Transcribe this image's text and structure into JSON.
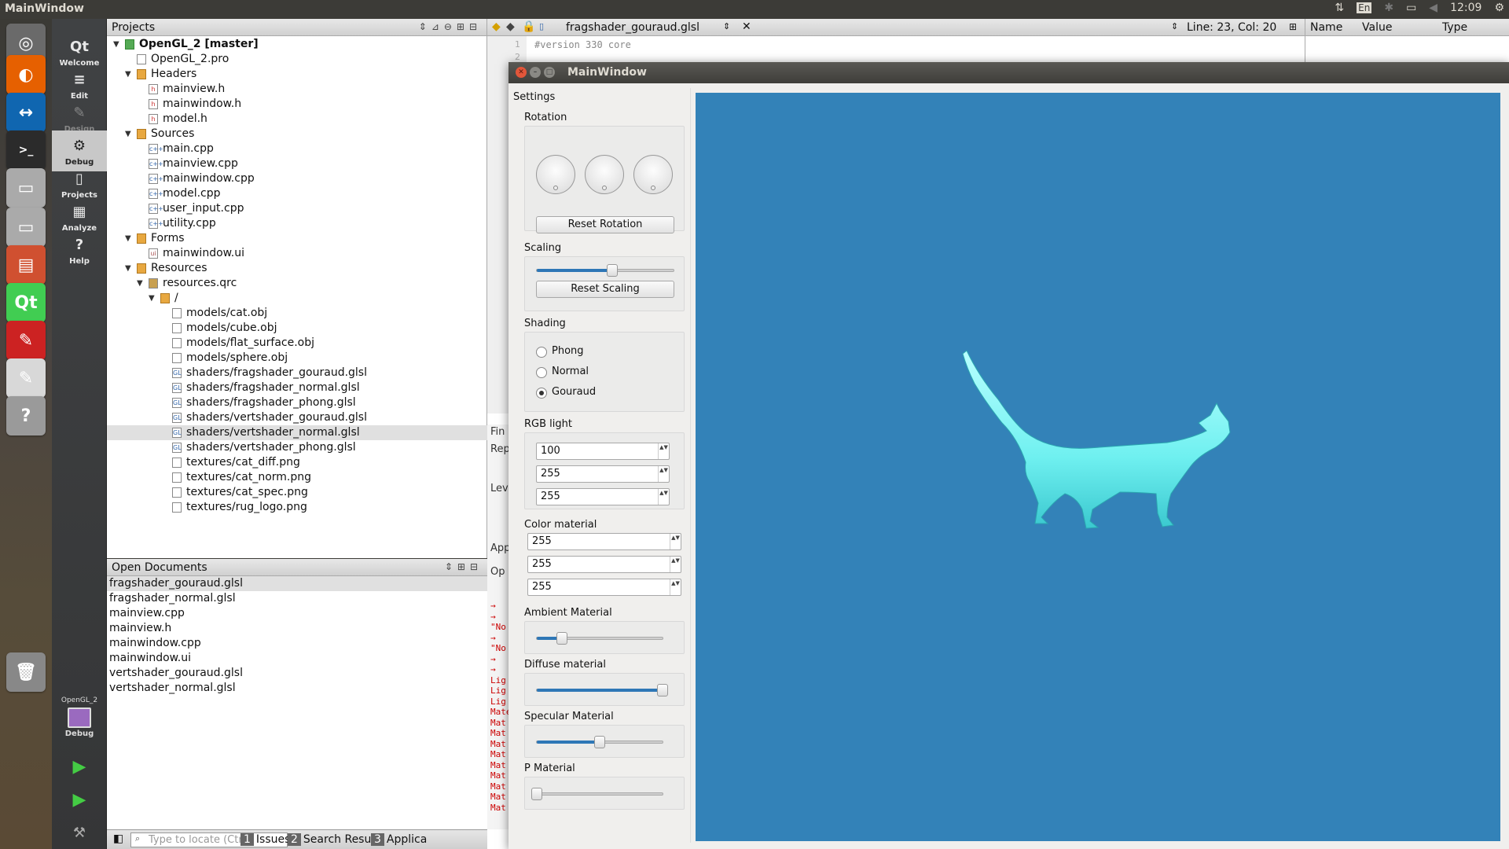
{
  "topbar": {
    "title": "MainWindow",
    "keyboard": "En",
    "time": "12:09"
  },
  "launcher": {
    "items": [
      {
        "name": "ubuntu-dash-icon",
        "glyph": "◎",
        "color": "#6a6a6a"
      },
      {
        "name": "firefox-icon",
        "glyph": "◐",
        "color": "#e66000"
      },
      {
        "name": "teamviewer-icon",
        "glyph": "↔",
        "color": "#1066b0"
      },
      {
        "name": "terminal-icon",
        "glyph": ">_",
        "color": "#2b2b2b"
      },
      {
        "name": "drive-icon-1",
        "glyph": "▭",
        "color": "#aaaaaa"
      },
      {
        "name": "drive-icon-2",
        "glyph": "▭",
        "color": "#aaaaaa"
      },
      {
        "name": "files-icon",
        "glyph": "▤",
        "color": "#d05030"
      },
      {
        "name": "qt-creator-icon",
        "glyph": "Qt",
        "color": "#41cd52"
      },
      {
        "name": "pdf-viewer-icon",
        "glyph": "✎",
        "color": "#cc2222"
      },
      {
        "name": "text-editor-icon",
        "glyph": "✎",
        "color": "#d8d8d8"
      },
      {
        "name": "help-icon",
        "glyph": "?",
        "color": "#9a9a9a"
      },
      {
        "name": "trash-icon",
        "glyph": "🗑",
        "color": "#888888"
      }
    ]
  },
  "modes": [
    {
      "id": "welcome",
      "label": "Welcome",
      "glyph": "Qt"
    },
    {
      "id": "edit",
      "label": "Edit",
      "glyph": "≡"
    },
    {
      "id": "design",
      "label": "Design",
      "glyph": "✎"
    },
    {
      "id": "debug",
      "label": "Debug",
      "glyph": "⚙"
    },
    {
      "id": "projects",
      "label": "Projects",
      "glyph": "▯"
    },
    {
      "id": "analyze",
      "label": "Analyze",
      "glyph": "▦"
    },
    {
      "id": "help",
      "label": "Help",
      "glyph": "?"
    }
  ],
  "kit": {
    "project": "OpenGL_2",
    "config": "Debug"
  },
  "projects_panel": {
    "title": "Projects",
    "tree": [
      {
        "label": "OpenGL_2 [master]",
        "depth": 0,
        "type": "proj",
        "expanded": true,
        "bold": true
      },
      {
        "label": "OpenGL_2.pro",
        "depth": 1,
        "type": "pro"
      },
      {
        "label": "Headers",
        "depth": 1,
        "type": "folder",
        "expanded": true
      },
      {
        "label": "mainview.h",
        "depth": 2,
        "type": "h"
      },
      {
        "label": "mainwindow.h",
        "depth": 2,
        "type": "h"
      },
      {
        "label": "model.h",
        "depth": 2,
        "type": "h"
      },
      {
        "label": "Sources",
        "depth": 1,
        "type": "folder",
        "expanded": true
      },
      {
        "label": "main.cpp",
        "depth": 2,
        "type": "cpp"
      },
      {
        "label": "mainview.cpp",
        "depth": 2,
        "type": "cpp"
      },
      {
        "label": "mainwindow.cpp",
        "depth": 2,
        "type": "cpp"
      },
      {
        "label": "model.cpp",
        "depth": 2,
        "type": "cpp"
      },
      {
        "label": "user_input.cpp",
        "depth": 2,
        "type": "cpp"
      },
      {
        "label": "utility.cpp",
        "depth": 2,
        "type": "cpp"
      },
      {
        "label": "Forms",
        "depth": 1,
        "type": "folder",
        "expanded": true
      },
      {
        "label": "mainwindow.ui",
        "depth": 2,
        "type": "ui"
      },
      {
        "label": "Resources",
        "depth": 1,
        "type": "folder",
        "expanded": true
      },
      {
        "label": "resources.qrc",
        "depth": 2,
        "type": "qrc",
        "expanded": true
      },
      {
        "label": "/",
        "depth": 3,
        "type": "folder",
        "expanded": true
      },
      {
        "label": "models/cat.obj",
        "depth": 4,
        "type": "file"
      },
      {
        "label": "models/cube.obj",
        "depth": 4,
        "type": "file"
      },
      {
        "label": "models/flat_surface.obj",
        "depth": 4,
        "type": "file"
      },
      {
        "label": "models/sphere.obj",
        "depth": 4,
        "type": "file"
      },
      {
        "label": "shaders/fragshader_gouraud.glsl",
        "depth": 4,
        "type": "gl"
      },
      {
        "label": "shaders/fragshader_normal.glsl",
        "depth": 4,
        "type": "gl"
      },
      {
        "label": "shaders/fragshader_phong.glsl",
        "depth": 4,
        "type": "gl"
      },
      {
        "label": "shaders/vertshader_gouraud.glsl",
        "depth": 4,
        "type": "gl"
      },
      {
        "label": "shaders/vertshader_normal.glsl",
        "depth": 4,
        "type": "gl",
        "selected": true
      },
      {
        "label": "shaders/vertshader_phong.glsl",
        "depth": 4,
        "type": "gl"
      },
      {
        "label": "textures/cat_diff.png",
        "depth": 4,
        "type": "file"
      },
      {
        "label": "textures/cat_norm.png",
        "depth": 4,
        "type": "file"
      },
      {
        "label": "textures/cat_spec.png",
        "depth": 4,
        "type": "file"
      },
      {
        "label": "textures/rug_logo.png",
        "depth": 4,
        "type": "file"
      }
    ]
  },
  "open_documents": {
    "title": "Open Documents",
    "items": [
      "fragshader_gouraud.glsl",
      "fragshader_normal.glsl",
      "mainview.cpp",
      "mainview.h",
      "mainwindow.cpp",
      "mainwindow.ui",
      "vertshader_gouraud.glsl",
      "vertshader_normal.glsl"
    ]
  },
  "statusbar": {
    "locate_placeholder": "Type to locate (Ctr...",
    "tabs": [
      {
        "num": "1",
        "label": "Issues"
      },
      {
        "num": "2",
        "label": "Search Results"
      },
      {
        "num": "3",
        "label": "Applica"
      }
    ]
  },
  "editor": {
    "filename": "fragshader_gouraud.glsl",
    "position": "Line: 23, Col: 20",
    "first_line": "#version 330 core",
    "gutter_numbers": [
      "1",
      "2"
    ]
  },
  "editor_strip": [
    "Fin",
    "Rep",
    "Lev",
    "App",
    "Op"
  ],
  "output_lines": [
    "→",
    "→",
    "\"No",
    "→",
    "\"No",
    "→",
    "→",
    "Lig",
    "Lig",
    "Lig",
    "Mate",
    "Mat",
    "Mat",
    "Mat",
    "Mat",
    "Mat",
    "Mat",
    "Mat",
    "Mat",
    "Mat"
  ],
  "locals_panel": {
    "columns": [
      "Name",
      "Value",
      "Type"
    ]
  },
  "app": {
    "title": "MainWindow",
    "settings_label": "Settings",
    "rotation": {
      "title": "Rotation",
      "reset_label": "Reset Rotation"
    },
    "scaling": {
      "title": "Scaling",
      "reset_label": "Reset Scaling",
      "level": 0.55
    },
    "shading": {
      "title": "Shading",
      "options": [
        "Phong",
        "Normal",
        "Gouraud"
      ],
      "selected": "Gouraud"
    },
    "rgb_light": {
      "title": "RGB light",
      "values": [
        "100",
        "255",
        "255"
      ]
    },
    "color_material": {
      "title": "Color material",
      "values": [
        "255",
        "255",
        "255"
      ]
    },
    "ambient": {
      "title": "Ambient Material",
      "level": 0.2
    },
    "diffuse": {
      "title": "Diffuse material",
      "level": 1.0
    },
    "specular": {
      "title": "Specular Material",
      "level": 0.5
    },
    "p_material": {
      "title": "P Material",
      "level": 0.0
    },
    "viewport_color": "#3382b8",
    "model_color": "#7ff5f5"
  }
}
